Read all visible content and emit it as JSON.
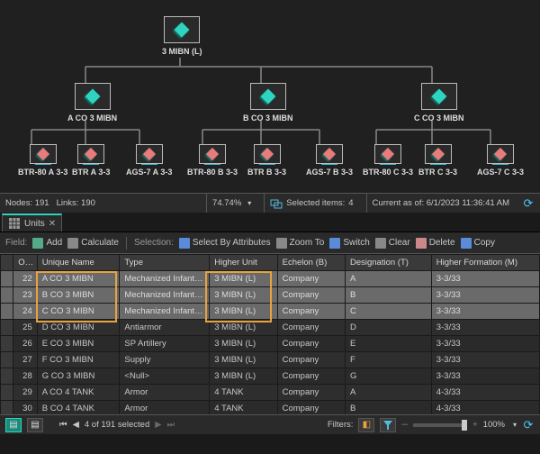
{
  "tree": {
    "root": {
      "label": "3 MIBN (L)"
    },
    "level2": [
      {
        "label": "A CO 3 MIBN"
      },
      {
        "label": "B CO 3 MIBN"
      },
      {
        "label": "C CO 3 MIBN"
      }
    ],
    "level3": [
      {
        "label": "BTR-80 A 3-3"
      },
      {
        "label": "BTR A 3-3"
      },
      {
        "label": "AGS-7 A 3-3"
      },
      {
        "label": "BTR-80 B 3-3"
      },
      {
        "label": "BTR B 3-3"
      },
      {
        "label": "AGS-7 B 3-3"
      },
      {
        "label": "BTR-80 C 3-3"
      },
      {
        "label": "BTR C 3-3"
      },
      {
        "label": "AGS-7 C 3-3"
      }
    ]
  },
  "status_top": {
    "nodes": "Nodes: 191",
    "links": "Links: 190",
    "zoom": "74.74%",
    "selected_label": "Selected items:",
    "selected_count": "4",
    "current_as_of": "Current as of: 6/1/2023 11:36:41 AM"
  },
  "tab": {
    "name": "Units"
  },
  "toolbar": {
    "field": "Field:",
    "add": "Add",
    "calculate": "Calculate",
    "selection": "Selection:",
    "select_by_attr": "Select By Attributes",
    "zoom_to": "Zoom To",
    "switch": "Switch",
    "clear": "Clear",
    "delete": "Delete",
    "copy": "Copy"
  },
  "columns": [
    "",
    "OID",
    "Unique Name",
    "Type",
    "Higher Unit",
    "Echelon (B)",
    "Designation (T)",
    "Higher Formation (M)"
  ],
  "rows": [
    {
      "sel": true,
      "oid": "22",
      "unique": "A CO 3 MIBN",
      "type": "Mechanized Infantry (Li…",
      "higher": "3 MIBN (L)",
      "echelon": "Company",
      "desig": "A",
      "hf": "3-3/33"
    },
    {
      "sel": true,
      "oid": "23",
      "unique": "B CO 3 MIBN",
      "type": "Mechanized Infantry (Li…",
      "higher": "3 MIBN (L)",
      "echelon": "Company",
      "desig": "B",
      "hf": "3-3/33"
    },
    {
      "sel": true,
      "oid": "24",
      "unique": "C CO 3 MIBN",
      "type": "Mechanized Infantry (Li…",
      "higher": "3 MIBN (L)",
      "echelon": "Company",
      "desig": "C",
      "hf": "3-3/33"
    },
    {
      "sel": false,
      "oid": "25",
      "unique": "D CO 3 MIBN",
      "type": "Antiarmor",
      "higher": "3 MIBN (L)",
      "echelon": "Company",
      "desig": "D",
      "hf": "3-3/33"
    },
    {
      "sel": false,
      "oid": "26",
      "unique": "E CO 3 MIBN",
      "type": "SP Artillery",
      "higher": "3 MIBN (L)",
      "echelon": "Company",
      "desig": "E",
      "hf": "3-3/33"
    },
    {
      "sel": false,
      "oid": "27",
      "unique": "F CO 3 MIBN",
      "type": "Supply",
      "higher": "3 MIBN (L)",
      "echelon": "Company",
      "desig": "F",
      "hf": "3-3/33"
    },
    {
      "sel": false,
      "oid": "28",
      "unique": "G CO 3 MIBN",
      "type": "<Null>",
      "higher": "3 MIBN (L)",
      "echelon": "Company",
      "desig": "G",
      "hf": "3-3/33"
    },
    {
      "sel": false,
      "oid": "29",
      "unique": "A CO 4 TANK",
      "type": "Armor",
      "higher": "4 TANK",
      "echelon": "Company",
      "desig": "A",
      "hf": "4-3/33"
    },
    {
      "sel": false,
      "oid": "30",
      "unique": "B CO 4 TANK",
      "type": "Armor",
      "higher": "4 TANK",
      "echelon": "Company",
      "desig": "B",
      "hf": "4-3/33"
    }
  ],
  "bottom": {
    "pager": "4 of 191 selected",
    "filters": "Filters:",
    "zoom": "100%"
  }
}
